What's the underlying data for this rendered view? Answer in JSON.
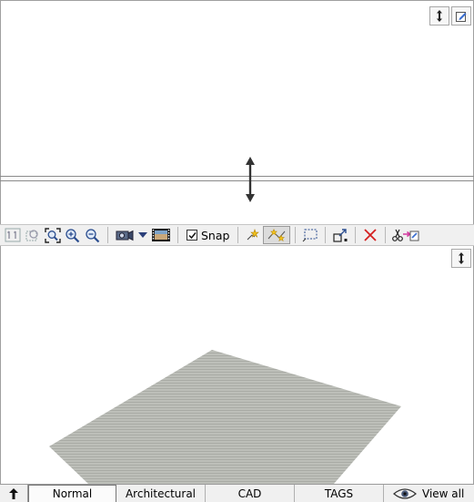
{
  "toolbar": {
    "snap_label": "Snap",
    "snap_checked": true
  },
  "status_bar": {
    "tabs": [
      {
        "label": "Normal",
        "active": true
      },
      {
        "label": "Architectural",
        "active": false
      },
      {
        "label": "CAD",
        "active": false
      },
      {
        "label": "TAGS",
        "active": false
      }
    ],
    "view_all_label": "View all"
  },
  "icons": {
    "top_corner": [
      "resize-vertical-icon",
      "edit-icon"
    ],
    "bottom_corner": [
      "resize-vertical-icon"
    ],
    "toolbar": [
      "zoom-one-to-one-icon",
      "zoom-selection-icon",
      "zoom-extents-icon",
      "zoom-in-icon",
      "zoom-out-icon",
      "camera-icon",
      "dropdown-arrow-icon",
      "film-strip-icon",
      "checkbox-icon",
      "add-point-icon",
      "edit-points-icon",
      "selection-rectangle-icon",
      "transform-icon",
      "delete-icon",
      "cut-paste-icon"
    ]
  },
  "colors": {
    "plane_fill": "#b9bbb5",
    "delete_red": "#d42020",
    "toolbar_bg": "#f0f0f0"
  }
}
